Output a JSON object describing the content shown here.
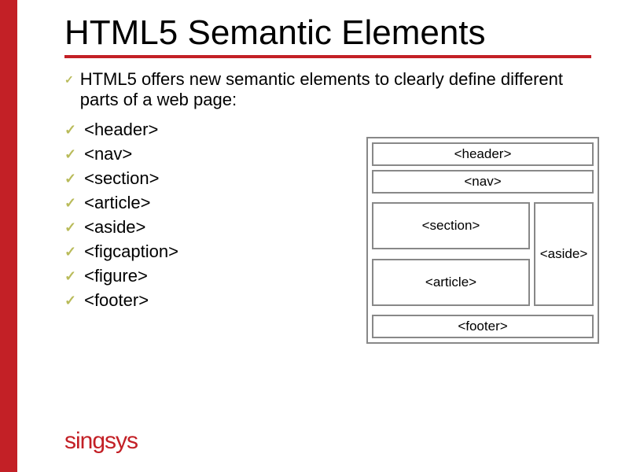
{
  "title": "HTML5 Semantic Elements",
  "intro": "HTML5 offers new semantic elements to clearly define different parts of a web page:",
  "items": [
    "<header>",
    "<nav>",
    "<section>",
    "<article>",
    "<aside>",
    "<figcaption>",
    "<figure>",
    "<footer>"
  ],
  "diagram": {
    "header": "<header>",
    "nav": "<nav>",
    "section": "<section>",
    "article": "<article>",
    "aside": "<aside>",
    "footer": "<footer>"
  },
  "brand": "singsys"
}
